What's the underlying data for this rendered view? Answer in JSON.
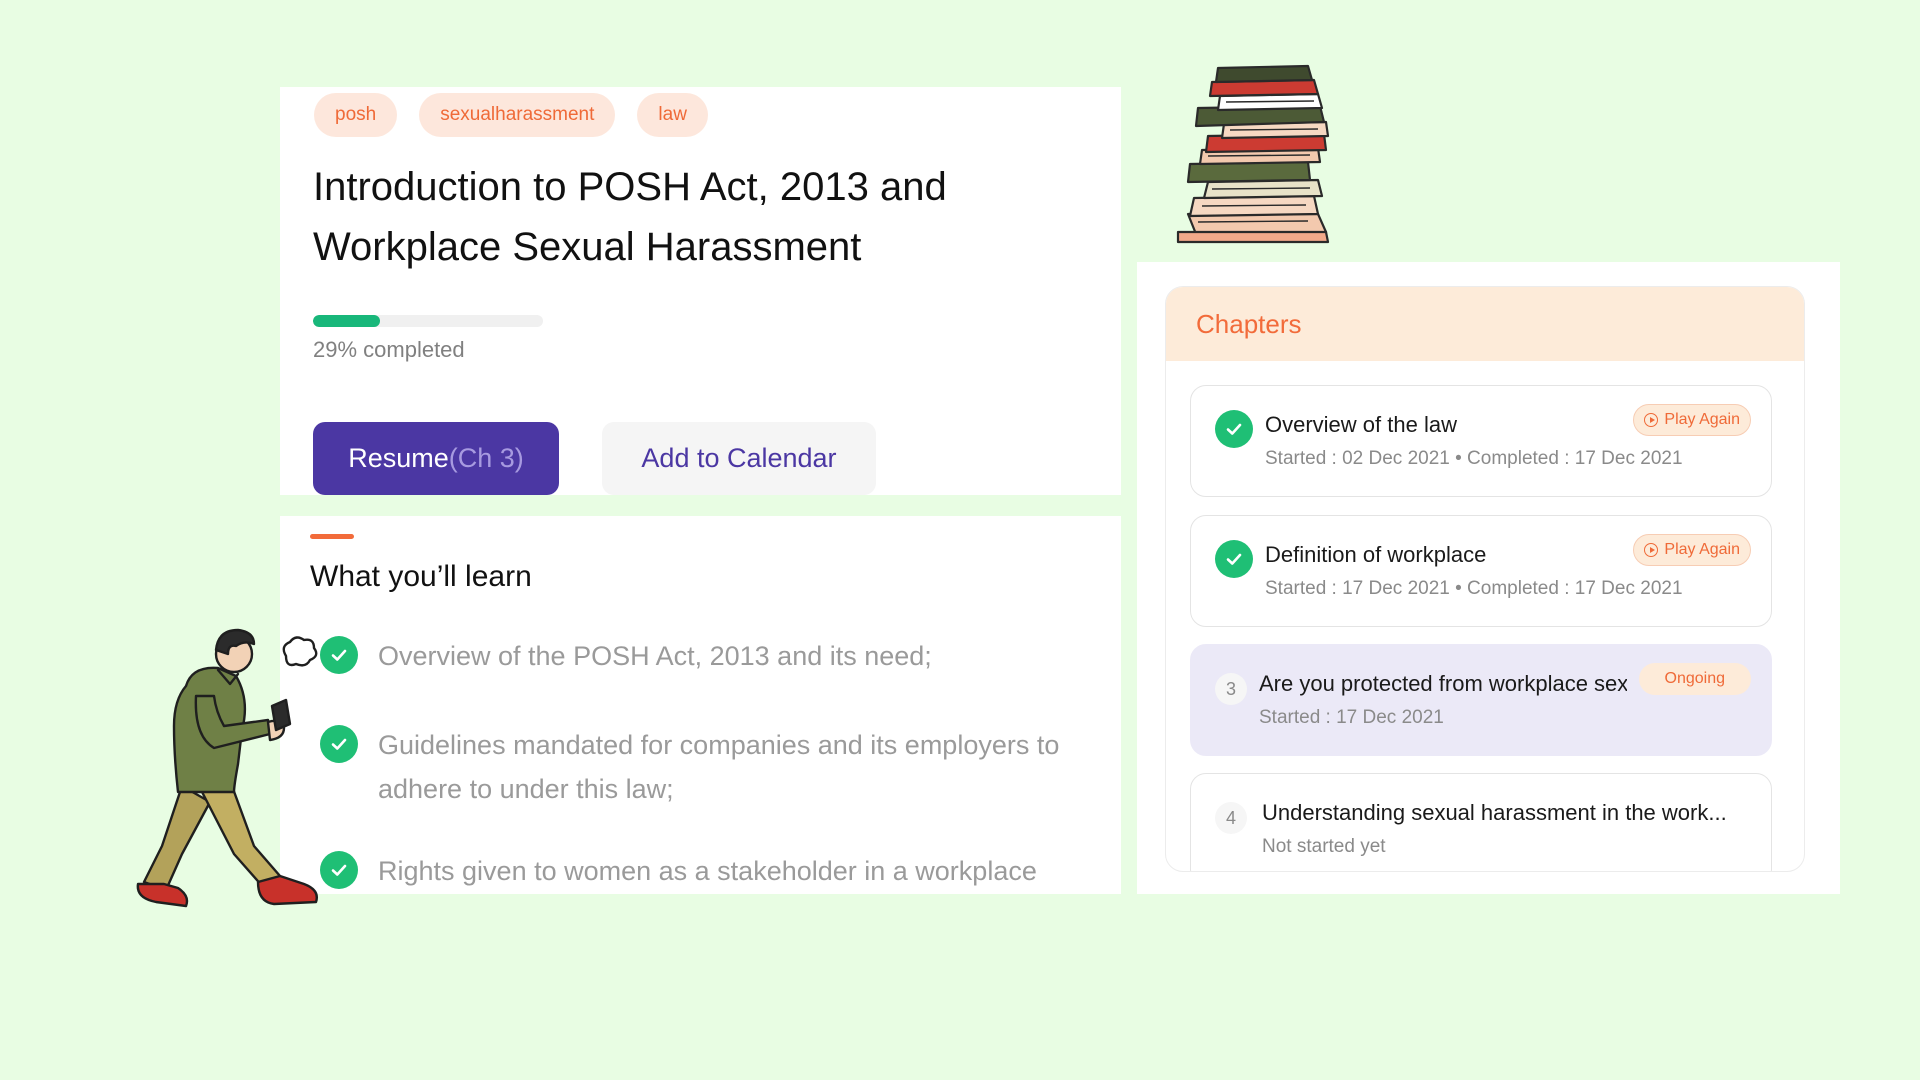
{
  "tags": [
    "posh",
    "sexualharassment",
    "law"
  ],
  "course": {
    "title_line1": "Introduction to POSH Act, 2013 and",
    "title_line2": "Workplace Sexual Harassment",
    "progress_percent": 29,
    "progress_label": "29% completed",
    "resume_label": "Resume",
    "resume_chapter": "(Ch 3)",
    "calendar_label": "Add to Calendar"
  },
  "learn": {
    "title": "What you’ll learn",
    "items": [
      "Overview of the POSH Act, 2013 and its need;",
      "Guidelines mandated for companies and its employers to adhere to under this law;",
      "Rights given to women as a stakeholder in a workplace"
    ]
  },
  "chapters": {
    "title": "Chapters",
    "items": [
      {
        "title": "Overview of the law",
        "meta": "Started : 02 Dec 2021 • Completed : 17 Dec 2021",
        "badge": "Play Again",
        "status": "completed"
      },
      {
        "title": "Definition of workplace",
        "meta": "Started : 17 Dec 2021 • Completed : 17 Dec 2021",
        "badge": "Play Again",
        "status": "completed"
      },
      {
        "number": "3",
        "title": "Are you protected from workplace sexual harassment?",
        "meta": "Started : 17 Dec 2021",
        "badge": "Ongoing",
        "status": "ongoing"
      },
      {
        "number": "4",
        "title": "Understanding sexual harassment in the work...",
        "meta": "Not started yet",
        "status": "not-started"
      }
    ]
  },
  "colors": {
    "background": "#e8fde3",
    "accent_orange": "#f26b3a",
    "primary_purple": "#4b37a3",
    "success_green": "#1fbf75"
  },
  "icons": [
    "check-icon",
    "play-circle-icon",
    "book-stack-illustration",
    "walking-man-illustration"
  ]
}
